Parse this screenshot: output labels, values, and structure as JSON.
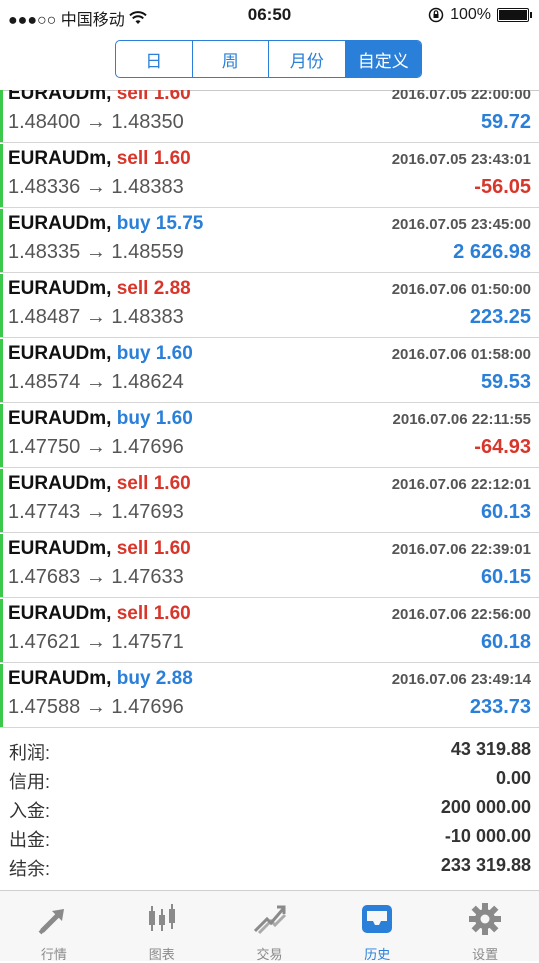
{
  "status": {
    "carrier": "●●●○○ 中国移动",
    "time": "06:50",
    "battery": "100%"
  },
  "segments": [
    "日",
    "周",
    "月份",
    "自定义"
  ],
  "active_segment": 3,
  "deals": [
    {
      "symbol": "EURAUDm,",
      "side": "sell",
      "volume": "1.60",
      "time": "2016.07.05 22:00:00",
      "prices": "1.48400 → 1.48350",
      "profit": "59.72"
    },
    {
      "symbol": "EURAUDm,",
      "side": "sell",
      "volume": "1.60",
      "time": "2016.07.05 23:43:01",
      "prices": "1.48336 → 1.48383",
      "profit": "-56.05"
    },
    {
      "symbol": "EURAUDm,",
      "side": "buy",
      "volume": "15.75",
      "time": "2016.07.05 23:45:00",
      "prices": "1.48335 → 1.48559",
      "profit": "2 626.98"
    },
    {
      "symbol": "EURAUDm,",
      "side": "sell",
      "volume": "2.88",
      "time": "2016.07.06 01:50:00",
      "prices": "1.48487 → 1.48383",
      "profit": "223.25"
    },
    {
      "symbol": "EURAUDm,",
      "side": "buy",
      "volume": "1.60",
      "time": "2016.07.06 01:58:00",
      "prices": "1.48574 → 1.48624",
      "profit": "59.53"
    },
    {
      "symbol": "EURAUDm,",
      "side": "buy",
      "volume": "1.60",
      "time": "2016.07.06 22:11:55",
      "prices": "1.47750 → 1.47696",
      "profit": "-64.93"
    },
    {
      "symbol": "EURAUDm,",
      "side": "sell",
      "volume": "1.60",
      "time": "2016.07.06 22:12:01",
      "prices": "1.47743 → 1.47693",
      "profit": "60.13"
    },
    {
      "symbol": "EURAUDm,",
      "side": "sell",
      "volume": "1.60",
      "time": "2016.07.06 22:39:01",
      "prices": "1.47683 → 1.47633",
      "profit": "60.15"
    },
    {
      "symbol": "EURAUDm,",
      "side": "sell",
      "volume": "1.60",
      "time": "2016.07.06 22:56:00",
      "prices": "1.47621 → 1.47571",
      "profit": "60.18"
    },
    {
      "symbol": "EURAUDm,",
      "side": "buy",
      "volume": "2.88",
      "time": "2016.07.06 23:49:14",
      "prices": "1.47588 → 1.47696",
      "profit": "233.73"
    }
  ],
  "summary": [
    {
      "label": "利润:",
      "value": "43 319.88"
    },
    {
      "label": "信用:",
      "value": "0.00"
    },
    {
      "label": "入金:",
      "value": "200 000.00"
    },
    {
      "label": "出金:",
      "value": "-10 000.00"
    },
    {
      "label": "结余:",
      "value": "233 319.88"
    }
  ],
  "tabs": [
    {
      "label": "行情",
      "icon": "quotes-arrows-icon"
    },
    {
      "label": "图表",
      "icon": "candlestick-chart-icon"
    },
    {
      "label": "交易",
      "icon": "trade-chart-icon"
    },
    {
      "label": "历史",
      "icon": "history-tray-icon"
    },
    {
      "label": "设置",
      "icon": "gear-icon"
    }
  ],
  "active_tab": 3,
  "colors": {
    "accent": "#2a7fd8",
    "sell": "#d8362a",
    "profit_negative": "#d8362a",
    "row_marker": "#3cc84a"
  }
}
